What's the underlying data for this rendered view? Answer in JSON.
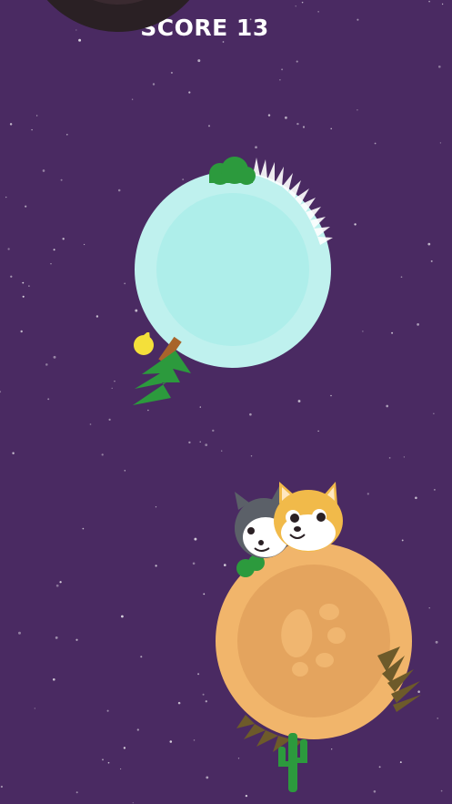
{
  "hud": {
    "score_label": "SCORE",
    "score_value": "13"
  },
  "colors": {
    "background": "#4a2a62",
    "ice_planet": "#bff1ee",
    "desert_planet": "#f1b56b",
    "dark_planet": "#2a2024",
    "tree": "#2c9a3d",
    "shiba": "#f1ba4a",
    "husky": "#5b6068"
  },
  "planets": [
    {
      "name": "dark-planet",
      "theme": "rock"
    },
    {
      "name": "ice-planet",
      "theme": "ice",
      "decorations": [
        "green-bush",
        "ice-spikes",
        "pine-tree",
        "yellow-bird"
      ]
    },
    {
      "name": "desert-planet",
      "theme": "desert",
      "decorations": [
        "paw-print",
        "brown-spikes",
        "cactus",
        "green-bush"
      ]
    }
  ],
  "characters": [
    "husky-dog",
    "shiba-dog"
  ]
}
